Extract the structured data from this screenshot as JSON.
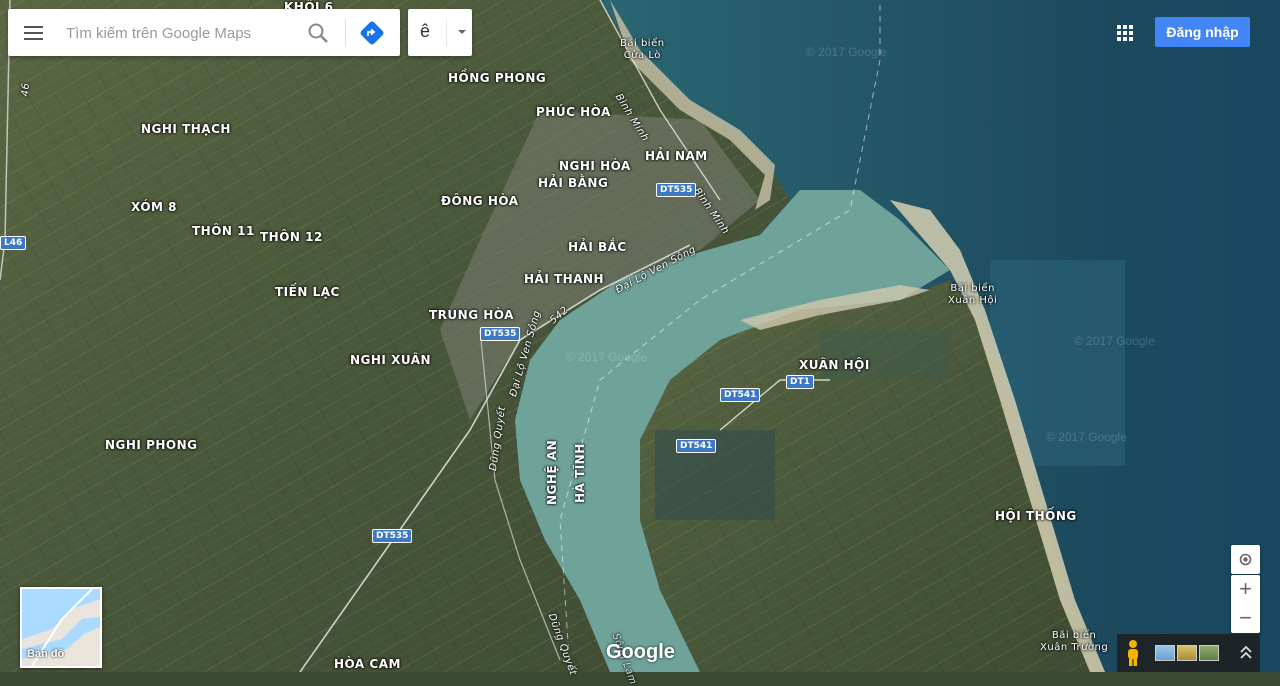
{
  "search": {
    "placeholder": "Tìm kiếm trên Google Maps"
  },
  "language": {
    "current": "ê"
  },
  "header": {
    "signin_label": "Đăng nhập"
  },
  "minimap": {
    "label": "Bản đồ"
  },
  "branding": {
    "logo": "Google",
    "watermark": "© 2017 Google"
  },
  "places": {
    "khoi6": "KHỐI 6",
    "hong_phong": "HỒNG PHONG",
    "phuc_hoa": "PHÚC HÒA",
    "nghi_thach": "NGHI THẠCH",
    "nghi_hoa": "NGHI HÒA",
    "hai_nam": "HẢI NAM",
    "hai_bang": "HẢI BẰNG",
    "dong_hoa": "ĐÔNG HÒA",
    "xom8": "XÓM 8",
    "thon11": "THÔN 11",
    "thon12": "THÔN 12",
    "hai_bac": "HẢI BẮC",
    "hai_thanh": "HẢI THANH",
    "tien_lac": "TIẾN LẠC",
    "trung_hoa": "TRUNG HÒA",
    "nghi_xuan": "NGHI XUÂN",
    "xuan_hoi": "XUÂN HỘI",
    "nghi_phong": "NGHI PHONG",
    "hoi_thong": "HỘI THỐNG",
    "hoa_cam": "HÒA CAM",
    "nghe_an": "NGHỆ AN",
    "ha_tinh": "HÀ TĨNH"
  },
  "beaches": {
    "cua_lo": [
      "Bãi biển",
      "Cửa Lò"
    ],
    "xuan_hoi": [
      "Bãi biển",
      "Xuân Hội"
    ],
    "xuan_truong": [
      "Bãi biển",
      "Xuân Trường"
    ]
  },
  "roads": {
    "binh_minh": "Bình Minh",
    "dai_lo_ven_song": "Đại Lộ Ven Sông",
    "dung_quyet": "Dũng Quyết",
    "r542": "542",
    "r46": "46",
    "song_lam": "Sông Lam"
  },
  "shields": {
    "dt535": "DT535",
    "dt541": "DT541",
    "dt1": "DT1",
    "l46": "L46"
  },
  "icons": {
    "menu": "menu-icon",
    "search": "search-icon",
    "directions": "directions-icon",
    "apps": "apps-grid-icon",
    "location": "my-location-icon",
    "pegman": "pegman-icon",
    "expand": "chevron-up-icon"
  },
  "controls": {
    "zoom_in": "+",
    "zoom_out": "−"
  },
  "colors": {
    "accent": "#4285f4",
    "water": "#6fa39a",
    "sea": "#1f5c70",
    "land": "#4b5a3c"
  }
}
